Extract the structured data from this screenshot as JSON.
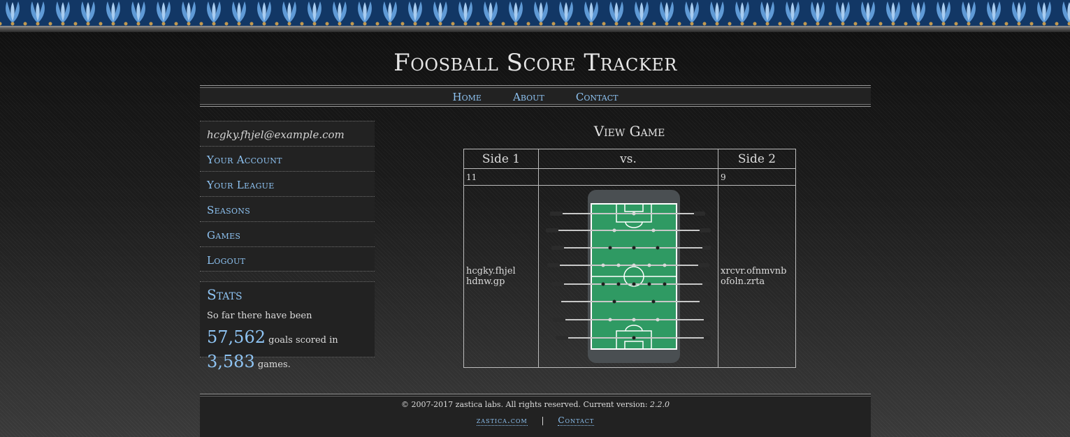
{
  "site": {
    "title": "Foosball Score Tracker"
  },
  "nav": [
    {
      "label": "Home"
    },
    {
      "label": "About"
    },
    {
      "label": "Contact"
    }
  ],
  "sidebar": {
    "user_email": "hcgky.fhjel@example.com",
    "items": [
      {
        "label": "Your Account"
      },
      {
        "label": "Your League"
      },
      {
        "label": "Seasons"
      },
      {
        "label": "Games"
      },
      {
        "label": "Logout"
      }
    ]
  },
  "stats": {
    "heading": "Stats",
    "text1": "So far there have been",
    "goals": "57,562",
    "text2": "goals scored in",
    "games": "3,583",
    "text3": "games."
  },
  "game": {
    "title": "View Game",
    "header": {
      "side1": "Side 1",
      "vs": "vs.",
      "side2": "Side 2"
    },
    "score1": "11",
    "score2": "9",
    "side1_players": [
      "hcgky.fhjel",
      "hdnw.gp"
    ],
    "side2_players": [
      "xrcvr.ofnmvnb",
      "ofoln.zrta"
    ],
    "table_image": "foosball-table-icon"
  },
  "footer": {
    "copyright": "© 2007-2017 zastica labs. All rights reserved. Current version:",
    "version": "2.2.0",
    "link1": "zastica.com",
    "separator": "|",
    "link2": "Contact"
  },
  "colors": {
    "link": "#8ec3f2",
    "banner": "#0f2c55",
    "pitch": "#2f9a63"
  }
}
